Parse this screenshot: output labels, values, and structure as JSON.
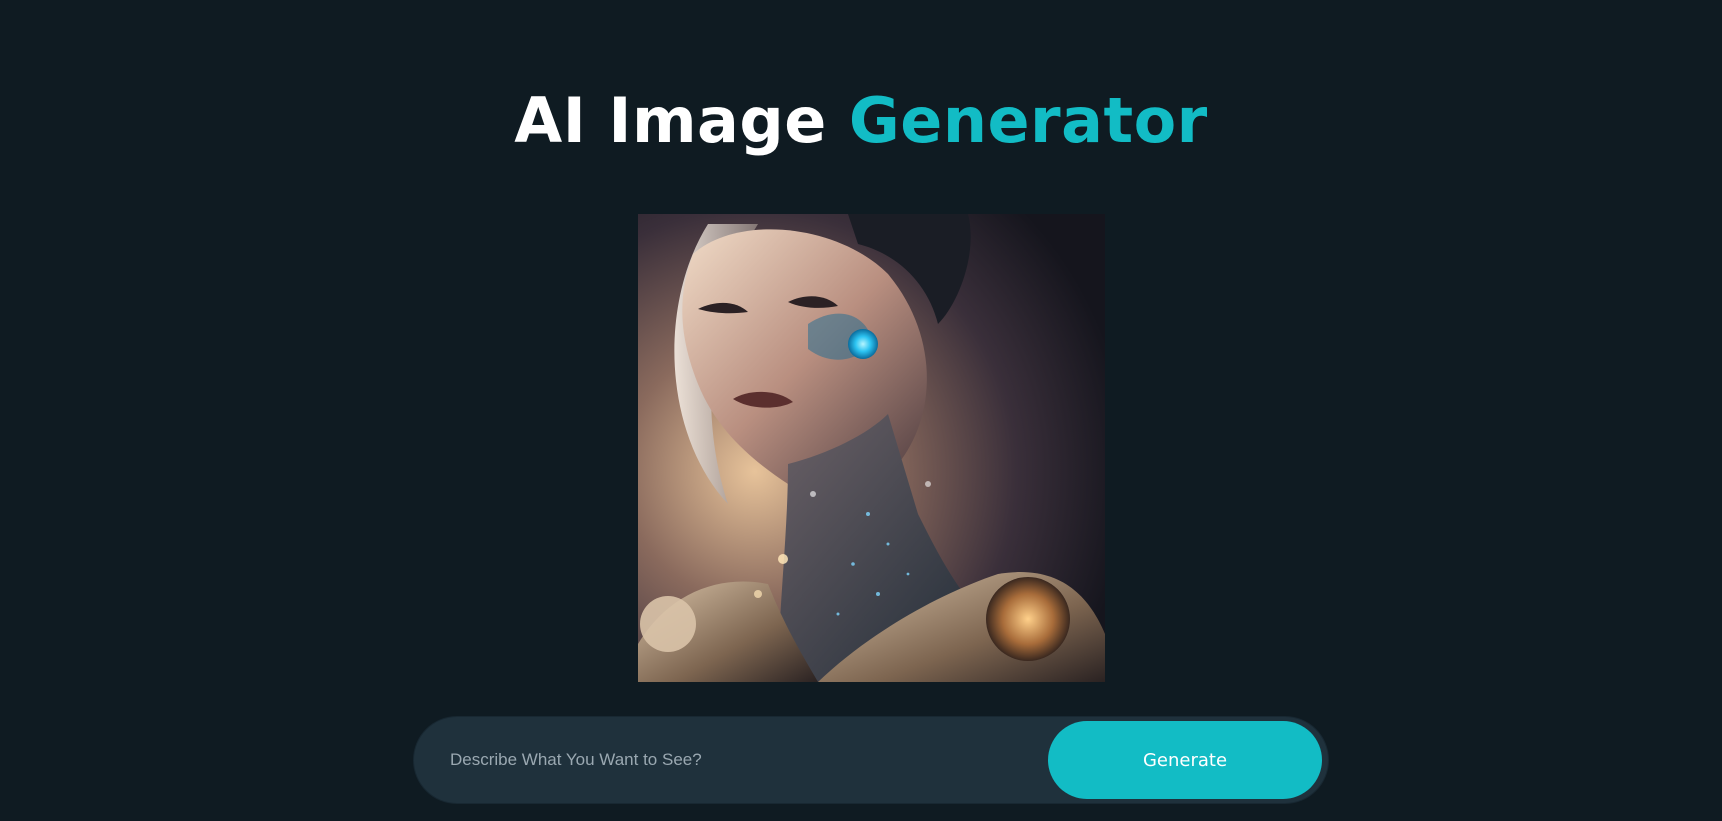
{
  "header": {
    "title_part1": "AI Image",
    "title_part2": "Generator"
  },
  "image": {
    "alt": "Generated image"
  },
  "prompt": {
    "placeholder": "Describe What You Want to See?",
    "value": ""
  },
  "actions": {
    "generate_label": "Generate"
  },
  "colors": {
    "background": "#0f1b22",
    "accent": "#12bcc5",
    "input_bg": "#1f313c",
    "text": "#ffffff"
  }
}
